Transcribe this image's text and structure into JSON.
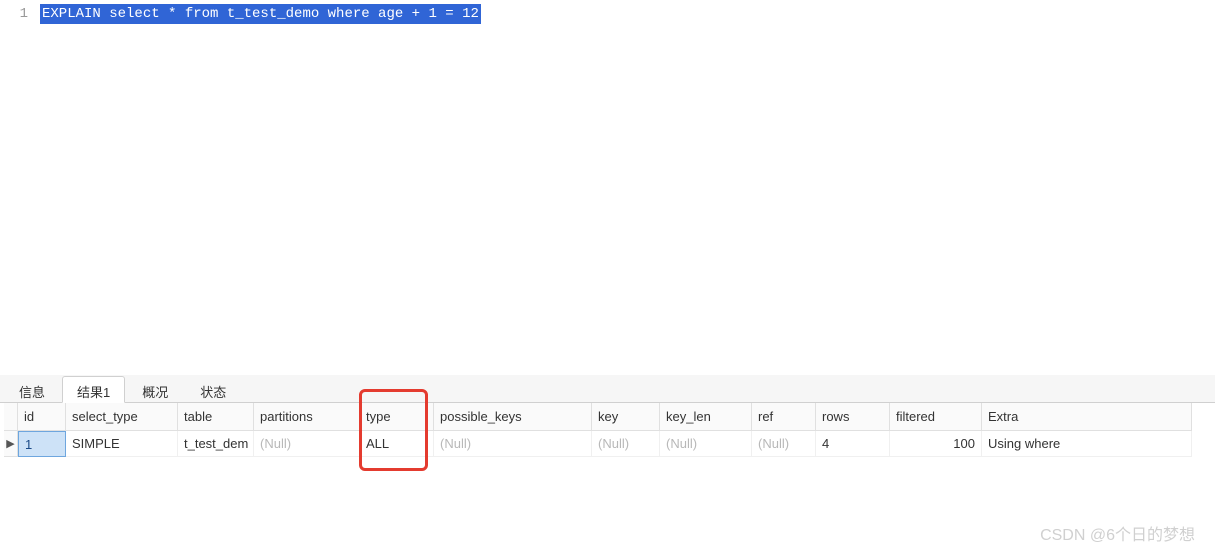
{
  "editor": {
    "line_number": "1",
    "sql": "EXPLAIN select * from t_test_demo where age + 1 = 12"
  },
  "tabs": {
    "items": [
      {
        "label": "信息"
      },
      {
        "label": "结果1"
      },
      {
        "label": "概况"
      },
      {
        "label": "状态"
      }
    ],
    "active_index": 1
  },
  "grid": {
    "headers": [
      "id",
      "select_type",
      "table",
      "partitions",
      "type",
      "possible_keys",
      "key",
      "key_len",
      "ref",
      "rows",
      "filtered",
      "Extra"
    ],
    "row_indicator": "▶",
    "rows": [
      {
        "id": "1",
        "select_type": "SIMPLE",
        "table": "t_test_dem",
        "partitions": "(Null)",
        "type": "ALL",
        "possible_keys": "(Null)",
        "key": "(Null)",
        "key_len": "(Null)",
        "ref": "(Null)",
        "rows": "4",
        "filtered": "100",
        "Extra": "Using where"
      }
    ]
  },
  "watermark": "CSDN @6个日的梦想"
}
